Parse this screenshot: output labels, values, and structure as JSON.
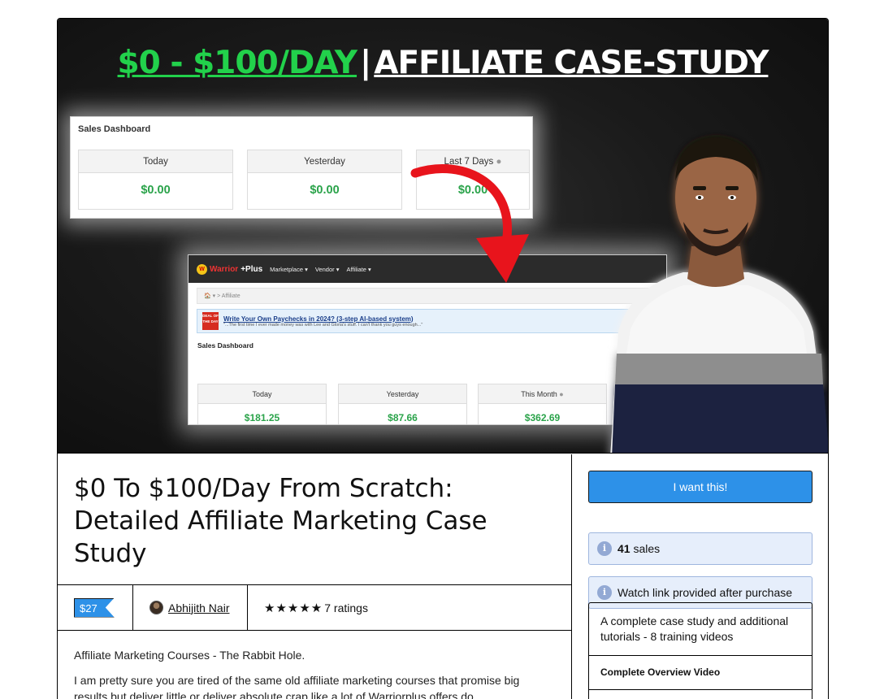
{
  "hero": {
    "headline_green": "$0 - $100/DAY",
    "headline_sep": "|",
    "headline_white": "AFFILIATE CASE-STUDY",
    "dashboard_before": {
      "title": "Sales Dashboard",
      "stats": [
        {
          "label": "Today",
          "value": "$0.00"
        },
        {
          "label": "Yesterday",
          "value": "$0.00"
        },
        {
          "label": "Last 7 Days",
          "value": "$0.00"
        }
      ]
    },
    "dashboard_after": {
      "brand_warrior": "Warrior",
      "brand_plus": "+Plus",
      "nav": [
        "Marketplace ▾",
        "Vendor ▾",
        "Affiliate ▾"
      ],
      "breadcrumb": "🏠 ▾  >  Affiliate",
      "deal_badge": "DEAL OF THE DAY",
      "deal_link": "Write Your Own Paychecks in 2024? (3-step AI-based system)",
      "deal_quote": "\"...The first time I ever made money was with Lee and Gloria's stuff. I can't thank you guys enough...\"",
      "title": "Sales Dashboard",
      "stats": [
        {
          "label": "Today",
          "value": "$181.25"
        },
        {
          "label": "Yesterday",
          "value": "$87.66"
        },
        {
          "label": "This Month",
          "value": "$362.69"
        }
      ]
    }
  },
  "product": {
    "title": "$0 To $100/Day From Scratch: Detailed Affiliate Marketing Case Study",
    "price": "$27",
    "author": "Abhijith Nair",
    "stars": "★★★★★",
    "ratings": "7 ratings",
    "description": [
      "Affiliate Marketing Courses - The Rabbit Hole.",
      "I am pretty sure you are tired of the same old affiliate marketing courses that promise big results but deliver little or deliver absolute crap like a lot of Warriorplus offers do."
    ]
  },
  "sidebar": {
    "cta_label": "I want this!",
    "sales_count": "41",
    "sales_label": "sales",
    "access_note": "Watch link provided after purchase",
    "contents_description": "A complete case study and additional tutorials - 8 training videos",
    "contents_items": [
      "Complete Overview Video"
    ]
  },
  "colors": {
    "accent_blue": "#2d91e8",
    "headline_green": "#22d14b",
    "money_green": "#2aa34a",
    "info_bg": "#e6eefb"
  }
}
